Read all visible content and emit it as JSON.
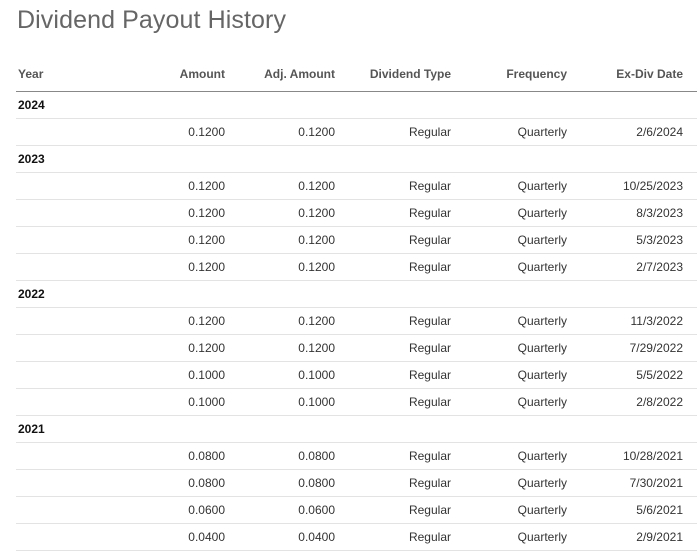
{
  "title": "Dividend Payout History",
  "table": {
    "headers": {
      "year": "Year",
      "amount": "Amount",
      "adj_amount": "Adj. Amount",
      "dividend_type": "Dividend Type",
      "frequency": "Frequency",
      "ex_div_date": "Ex-Div Date"
    },
    "groups": [
      {
        "year": "2024",
        "rows": [
          {
            "amount": "0.1200",
            "adj_amount": "0.1200",
            "type": "Regular",
            "frequency": "Quarterly",
            "date": "2/6/2024"
          }
        ]
      },
      {
        "year": "2023",
        "rows": [
          {
            "amount": "0.1200",
            "adj_amount": "0.1200",
            "type": "Regular",
            "frequency": "Quarterly",
            "date": "10/25/2023"
          },
          {
            "amount": "0.1200",
            "adj_amount": "0.1200",
            "type": "Regular",
            "frequency": "Quarterly",
            "date": "8/3/2023"
          },
          {
            "amount": "0.1200",
            "adj_amount": "0.1200",
            "type": "Regular",
            "frequency": "Quarterly",
            "date": "5/3/2023"
          },
          {
            "amount": "0.1200",
            "adj_amount": "0.1200",
            "type": "Regular",
            "frequency": "Quarterly",
            "date": "2/7/2023"
          }
        ]
      },
      {
        "year": "2022",
        "rows": [
          {
            "amount": "0.1200",
            "adj_amount": "0.1200",
            "type": "Regular",
            "frequency": "Quarterly",
            "date": "11/3/2022"
          },
          {
            "amount": "0.1200",
            "adj_amount": "0.1200",
            "type": "Regular",
            "frequency": "Quarterly",
            "date": "7/29/2022"
          },
          {
            "amount": "0.1000",
            "adj_amount": "0.1000",
            "type": "Regular",
            "frequency": "Quarterly",
            "date": "5/5/2022"
          },
          {
            "amount": "0.1000",
            "adj_amount": "0.1000",
            "type": "Regular",
            "frequency": "Quarterly",
            "date": "2/8/2022"
          }
        ]
      },
      {
        "year": "2021",
        "rows": [
          {
            "amount": "0.0800",
            "adj_amount": "0.0800",
            "type": "Regular",
            "frequency": "Quarterly",
            "date": "10/28/2021"
          },
          {
            "amount": "0.0800",
            "adj_amount": "0.0800",
            "type": "Regular",
            "frequency": "Quarterly",
            "date": "7/30/2021"
          },
          {
            "amount": "0.0600",
            "adj_amount": "0.0600",
            "type": "Regular",
            "frequency": "Quarterly",
            "date": "5/6/2021"
          },
          {
            "amount": "0.0400",
            "adj_amount": "0.0400",
            "type": "Regular",
            "frequency": "Quarterly",
            "date": "2/9/2021"
          }
        ]
      }
    ]
  }
}
